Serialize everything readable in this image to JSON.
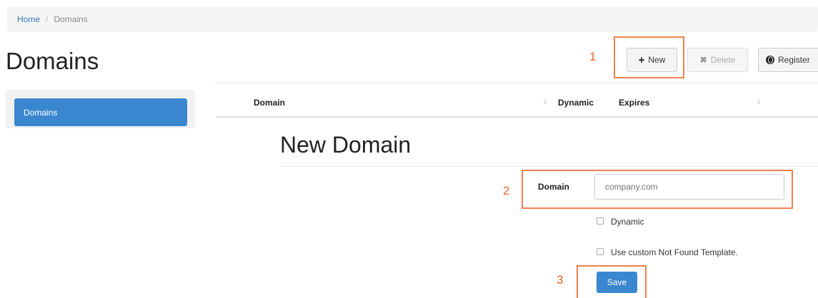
{
  "breadcrumb": {
    "home": "Home",
    "separator": "/",
    "current": "Domains"
  },
  "page": {
    "title": "Domains"
  },
  "toolbar": {
    "new_label": "New",
    "delete_label": "Delete",
    "register_label": "Register"
  },
  "sidebar": {
    "items": [
      {
        "label": "Domains",
        "active": true
      }
    ]
  },
  "table": {
    "columns": [
      "Domain",
      "Dynamic",
      "Expires"
    ]
  },
  "form": {
    "title": "New Domain",
    "domain_label": "Domain",
    "domain_placeholder": "company.com",
    "dynamic_label": "Dynamic",
    "custom_template_label": "Use custom Not Found Template.",
    "save_label": "Save"
  },
  "annotations": [
    "1",
    "2",
    "3"
  ],
  "colors": {
    "primary": "#3b87cf",
    "annotation": "#f0824e",
    "link": "#337ab7"
  },
  "icons": {
    "new": "plus-icon",
    "delete": "x-icon",
    "register": "globe-icon",
    "sort": "sort-icon"
  }
}
